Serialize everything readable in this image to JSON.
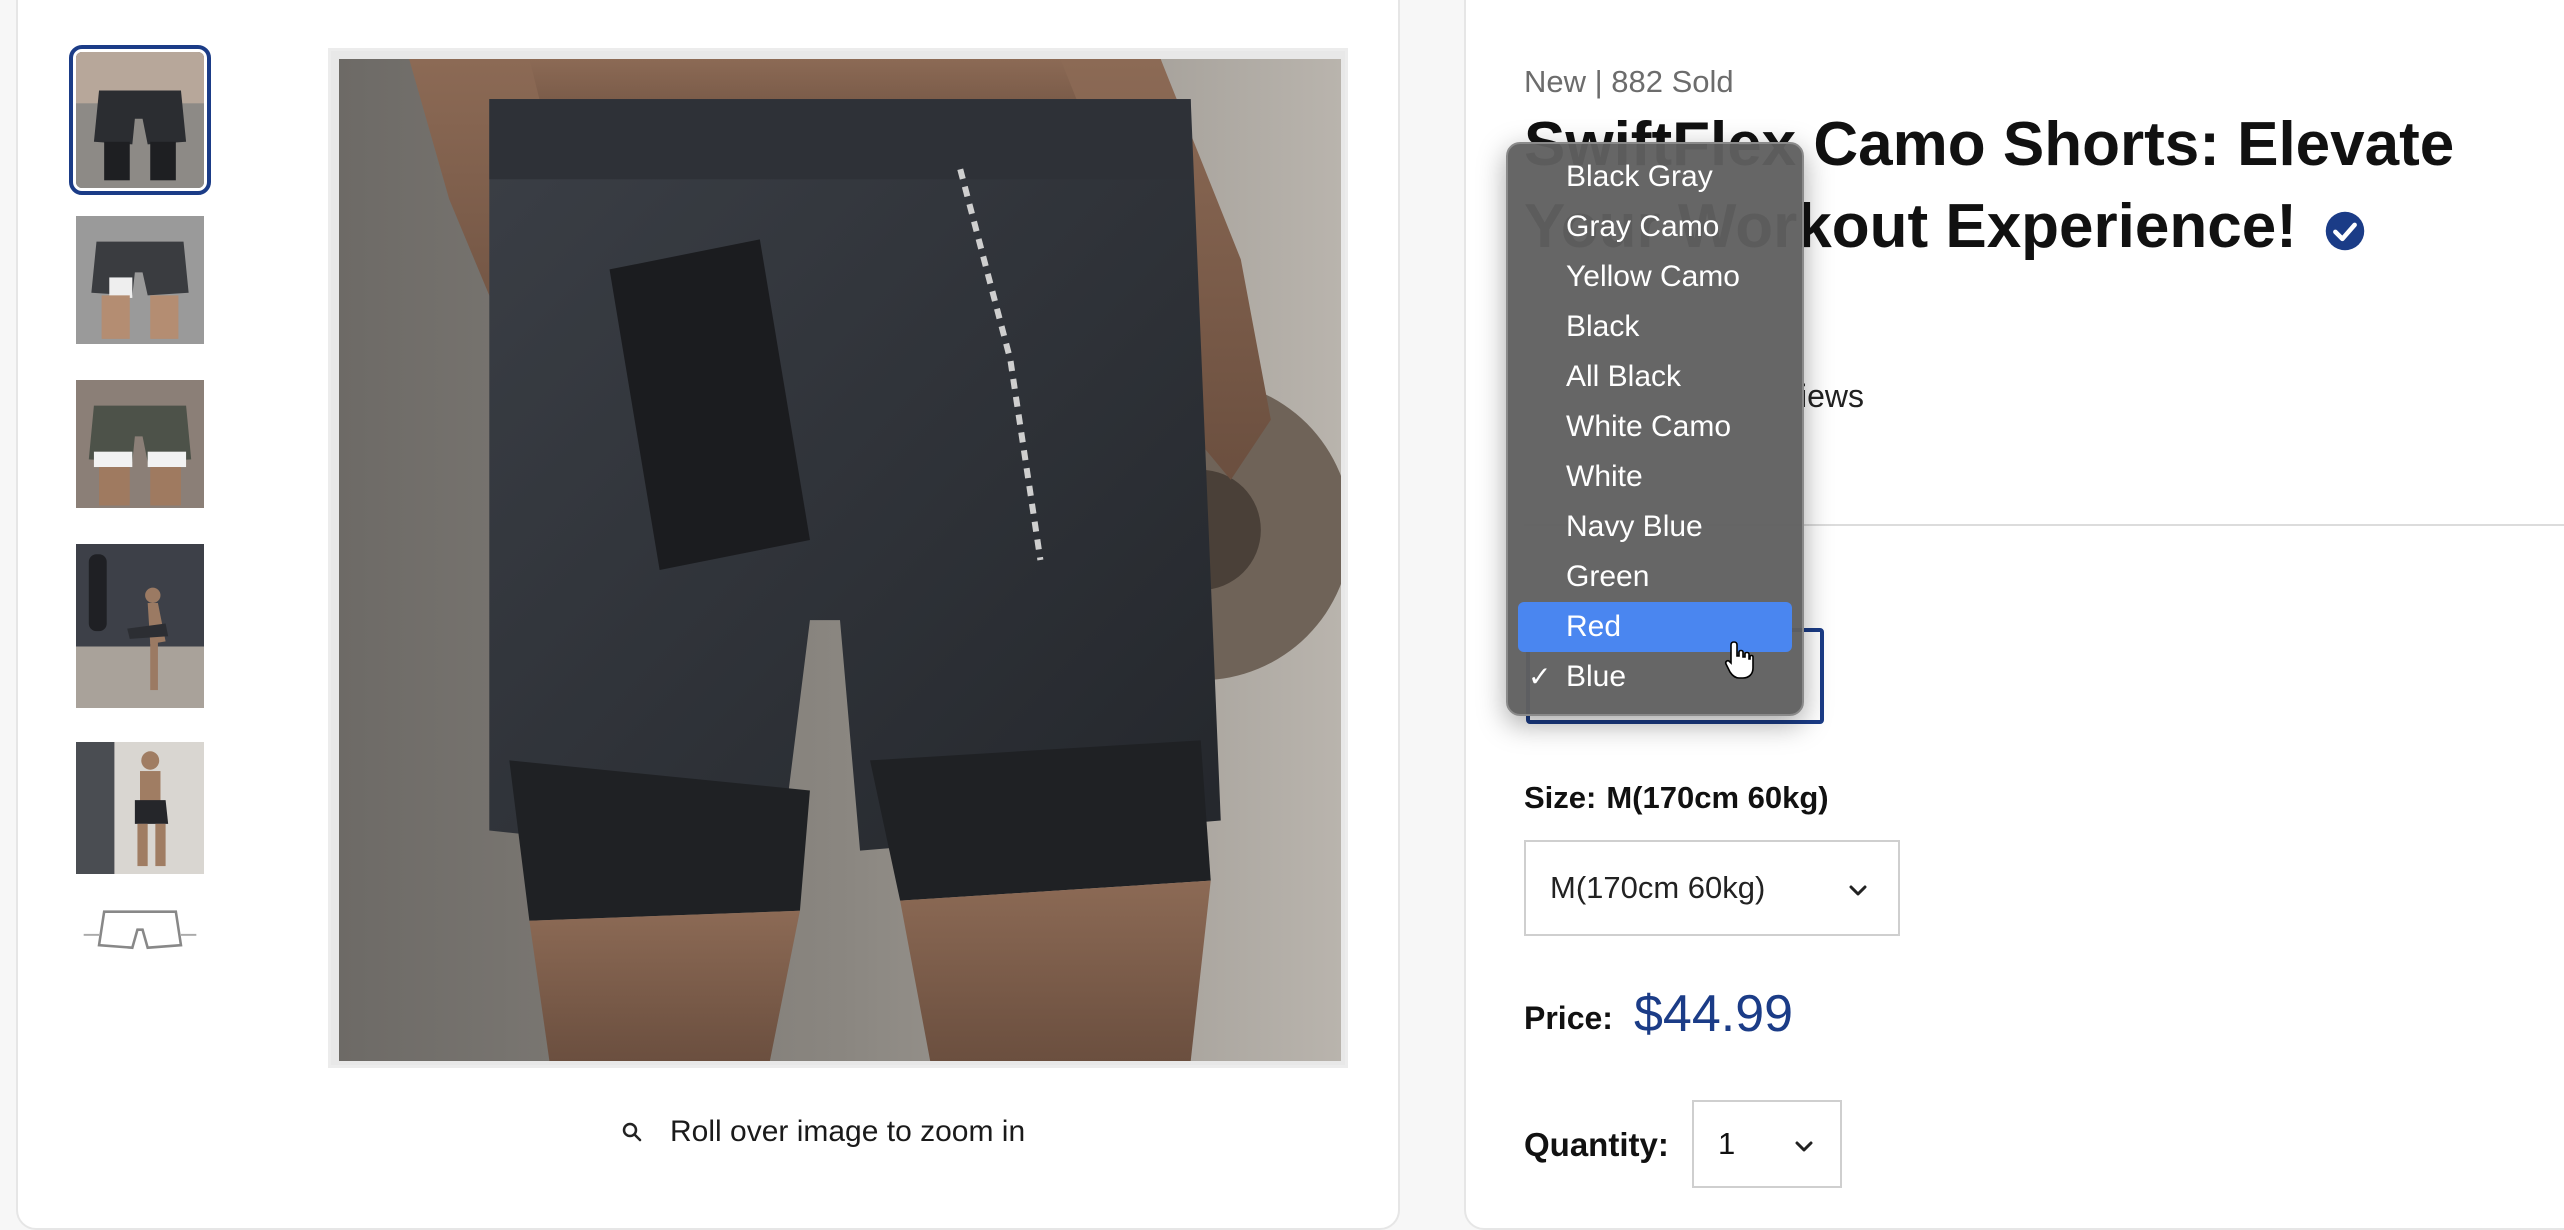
{
  "product": {
    "meta": "New | 882 Sold",
    "title": "SwiftFlex Camo Shorts: Elevate Your Workout Experience!",
    "reviews_partial": "iews"
  },
  "gallery": {
    "thumbnail_count": 6,
    "selected_index": 0,
    "zoom_hint": "Roll over image to zoom in"
  },
  "color": {
    "options": [
      {
        "label": "Black Gray"
      },
      {
        "label": "Gray Camo"
      },
      {
        "label": "Yellow Camo"
      },
      {
        "label": "Black"
      },
      {
        "label": "All Black"
      },
      {
        "label": "White Camo"
      },
      {
        "label": "White"
      },
      {
        "label": "Navy Blue"
      },
      {
        "label": "Green"
      },
      {
        "label": "Red"
      },
      {
        "label": "Blue"
      }
    ],
    "highlighted": "Red",
    "selected": "Blue",
    "check_mark": "✓"
  },
  "size": {
    "label": "Size:",
    "value": "M(170cm 60kg)",
    "selected_option": "M(170cm 60kg)"
  },
  "price": {
    "label": "Price:",
    "value": "$44.99"
  },
  "quantity": {
    "label": "Quantity:",
    "value": "1"
  },
  "colors": {
    "accent": "#1b3c87",
    "highlight": "#4a86f0",
    "verified": "#1b3c87"
  },
  "icons": {
    "zoom": "search-icon",
    "verified": "verified-check-icon",
    "select_arrow": "chevron-down-icon",
    "cursor": "hand-pointer-icon"
  }
}
